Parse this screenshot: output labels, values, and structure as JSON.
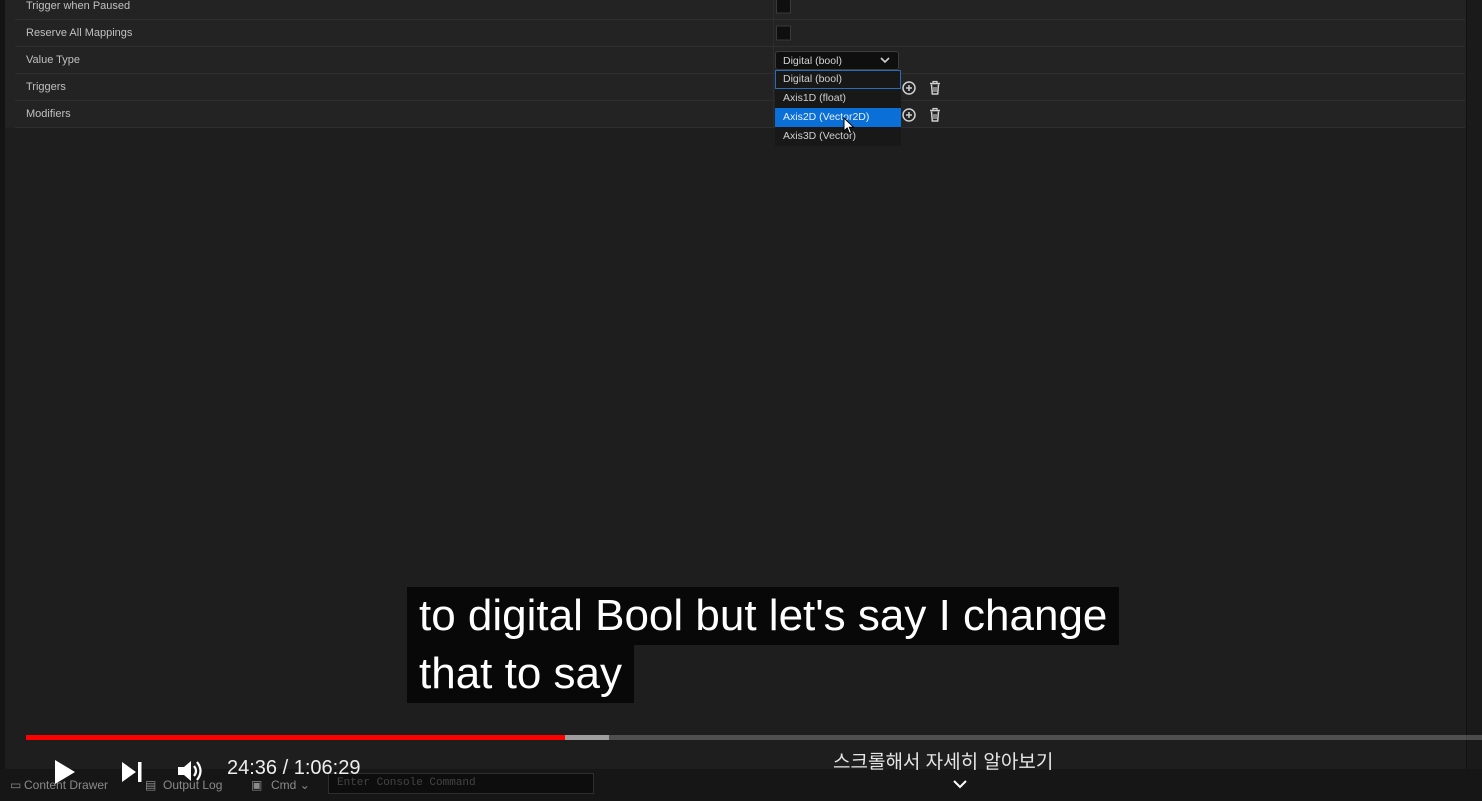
{
  "details": {
    "rows": [
      {
        "label": "Trigger when Paused"
      },
      {
        "label": "Reserve All Mappings"
      },
      {
        "label": "Value Type"
      },
      {
        "label": "Triggers"
      },
      {
        "label": "Modifiers"
      }
    ],
    "value_type_selected": "Digital (bool)",
    "value_type_options": [
      "Digital (bool)",
      "Axis1D (float)",
      "Axis2D (Vector2D)",
      "Axis3D (Vector)"
    ]
  },
  "editor_bottom_bar": {
    "content_drawer": "Content Drawer",
    "output_log": "Output Log",
    "cmd": "Cmd",
    "console_placeholder": "Enter Console Command"
  },
  "video": {
    "subtitle_line1": "to digital Bool but let's say I change",
    "subtitle_line2": "that to say",
    "time": "24:36 / 1:06:29",
    "progress_played_fraction": 0.3703,
    "progress_buffered_fraction": 0.4003,
    "explore_label": "스크롤해서 자세히 알아보기",
    "colors": {
      "played": "#ff0000",
      "hover_option": "#0a6fd6"
    }
  }
}
